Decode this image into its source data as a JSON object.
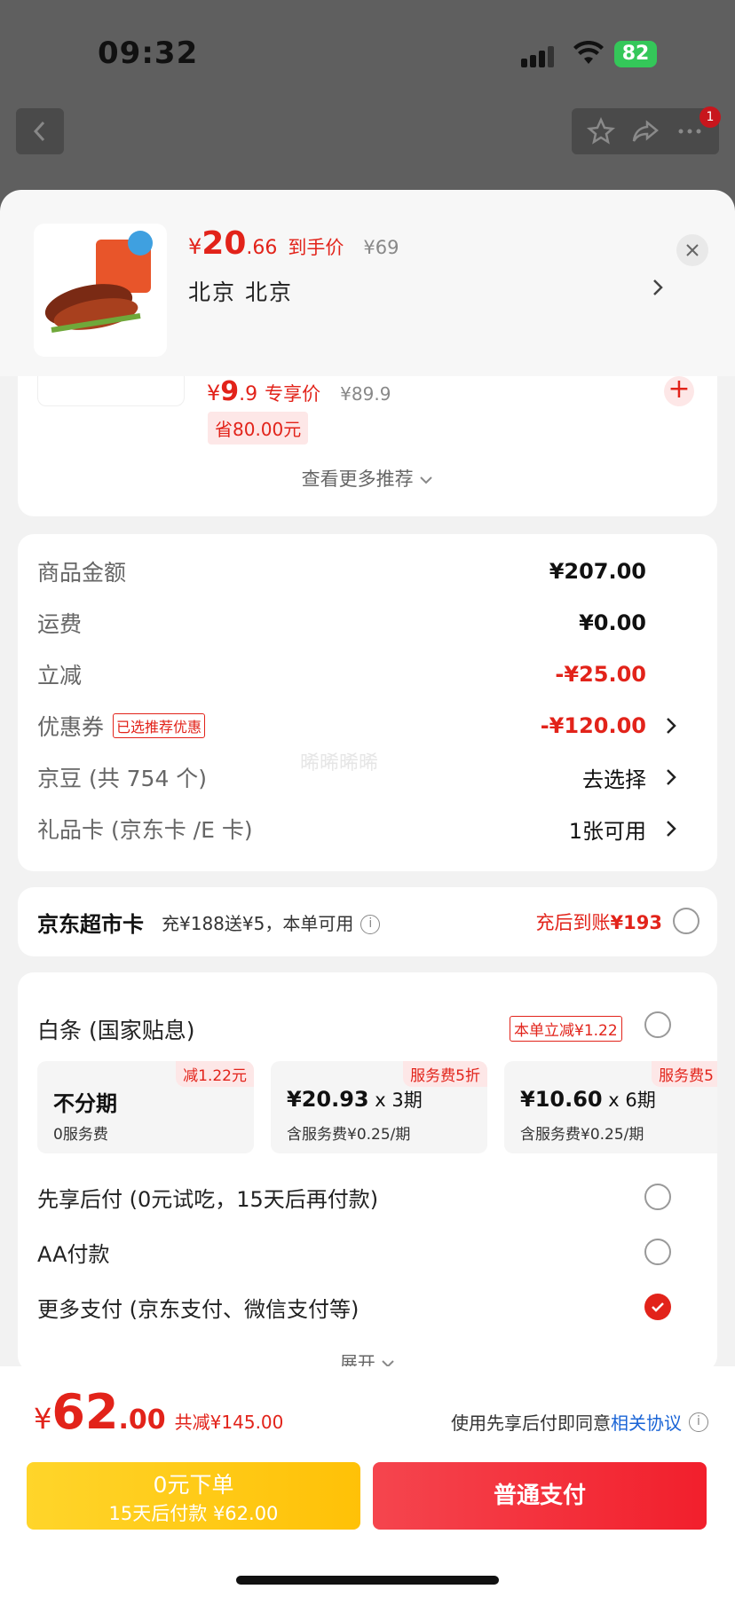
{
  "status": {
    "time": "09:32",
    "battery": "82"
  },
  "nav": {
    "badge_count": "1"
  },
  "product": {
    "currency": "¥",
    "price_int": "20",
    "price_dec": ".66",
    "price_tag": "到手价",
    "orig_price": "¥69",
    "location": "北京  北京"
  },
  "recommend": {
    "currency": "¥",
    "price": "9",
    "price_dec": ".9",
    "price_tag": "专享价",
    "orig_price": "¥89.9",
    "save": "省80.00元",
    "more": "查看更多推荐"
  },
  "totals": {
    "rows": [
      {
        "label": "商品金额",
        "value": "¥207.00"
      },
      {
        "label": "运费",
        "value": "¥0.00"
      },
      {
        "label": "立减",
        "value": "-¥25.00"
      },
      {
        "label": "优惠券",
        "tag": "已选推荐优惠",
        "value": "-¥120.00"
      },
      {
        "label": "京豆 (共 754 个)",
        "value": "去选择"
      },
      {
        "label": "礼品卡 (京东卡 /E 卡)",
        "value": "1张可用"
      }
    ],
    "watermark": "晞晞晞晞"
  },
  "supermarket": {
    "title": "京东超市卡",
    "desc": "充¥188送¥5，本单可用",
    "right_prefix": "充后到账",
    "right_amount": "¥193"
  },
  "payment": {
    "baitiao": "白条 (国家贴息)",
    "baitiao_badge": "本单立减¥1.22",
    "plans": [
      {
        "tag": "减1.22元",
        "main": "不分期",
        "sub": "0服务费"
      },
      {
        "tag": "服务费5折",
        "main": "¥20.93",
        "mult": " x 3期",
        "sub": "含服务费¥0.25/期"
      },
      {
        "tag": "服务费5",
        "main": "¥10.60",
        "mult": " x 6期",
        "sub": "含服务费¥0.25/期"
      }
    ],
    "options": [
      "先享后付 (0元试吃，15天后再付款)",
      "AA付款",
      "更多支付 (京东支付、微信支付等)"
    ],
    "expand": "展开"
  },
  "footer": {
    "currency": "¥",
    "total_int": "62",
    "total_dec": ".00",
    "saved": "共减¥145.00",
    "agree_text": "使用先享后付即同意",
    "agree_link": "相关协议",
    "btn_left_l1": "0元下单",
    "btn_left_l2": "15天后付款 ¥62.00",
    "btn_right": "普通支付"
  },
  "colors": {
    "accent": "#e2231a",
    "link": "#1a64d6",
    "yellow": "#ffc107"
  }
}
